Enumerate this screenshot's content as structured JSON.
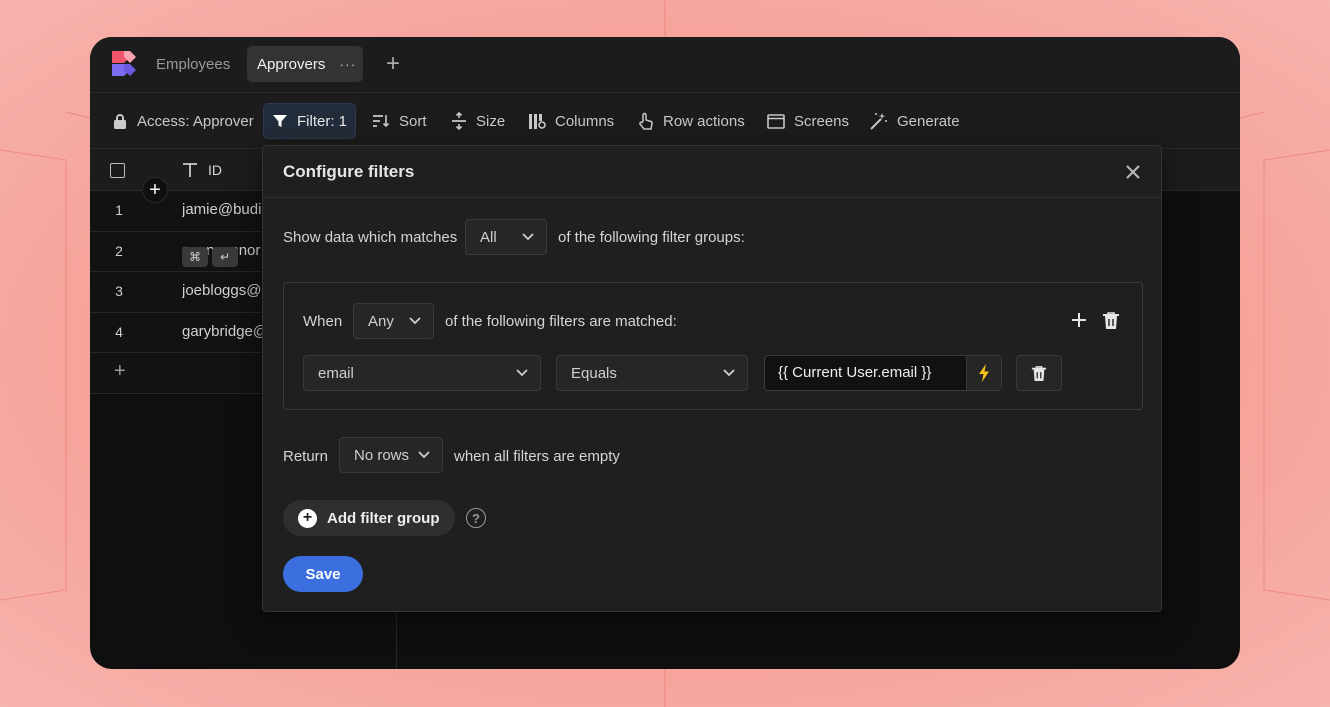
{
  "tabs": [
    {
      "label": "Employees",
      "active": false
    },
    {
      "label": "Approvers",
      "active": true
    }
  ],
  "tab_more": "···",
  "toolbar": {
    "access": "Access: Approver",
    "filter": "Filter: 1",
    "sort": "Sort",
    "size": "Size",
    "columns": "Columns",
    "row_actions": "Row actions",
    "screens": "Screens",
    "generate": "Generate"
  },
  "table": {
    "column": "ID",
    "rows": [
      {
        "num": "1",
        "value": "jamie@budi"
      },
      {
        "num": "2",
        "value": "seanconnor"
      },
      {
        "num": "3",
        "value": "joebloggs@l"
      },
      {
        "num": "4",
        "value": "garybridge@"
      }
    ],
    "kbd_cmd": "⌘",
    "kbd_enter": "↵"
  },
  "modal": {
    "title": "Configure filters",
    "match_prefix": "Show data which matches",
    "match_value": "All",
    "match_suffix": "of the following filter groups:",
    "group": {
      "when": "When",
      "any_value": "Any",
      "any_suffix": "of the following filters are matched:",
      "field": "email",
      "operator": "Equals",
      "binding": "{{ Current User.email }}"
    },
    "return_label": "Return",
    "return_value": "No rows",
    "return_suffix": "when all filters are empty",
    "add_group": "Add filter group",
    "help": "?",
    "save": "Save"
  },
  "colors": {
    "accent": "#3b6fe0",
    "bolt": "#f5c518",
    "logo_red": "#f0566b",
    "logo_purple": "#7b6cf0"
  }
}
